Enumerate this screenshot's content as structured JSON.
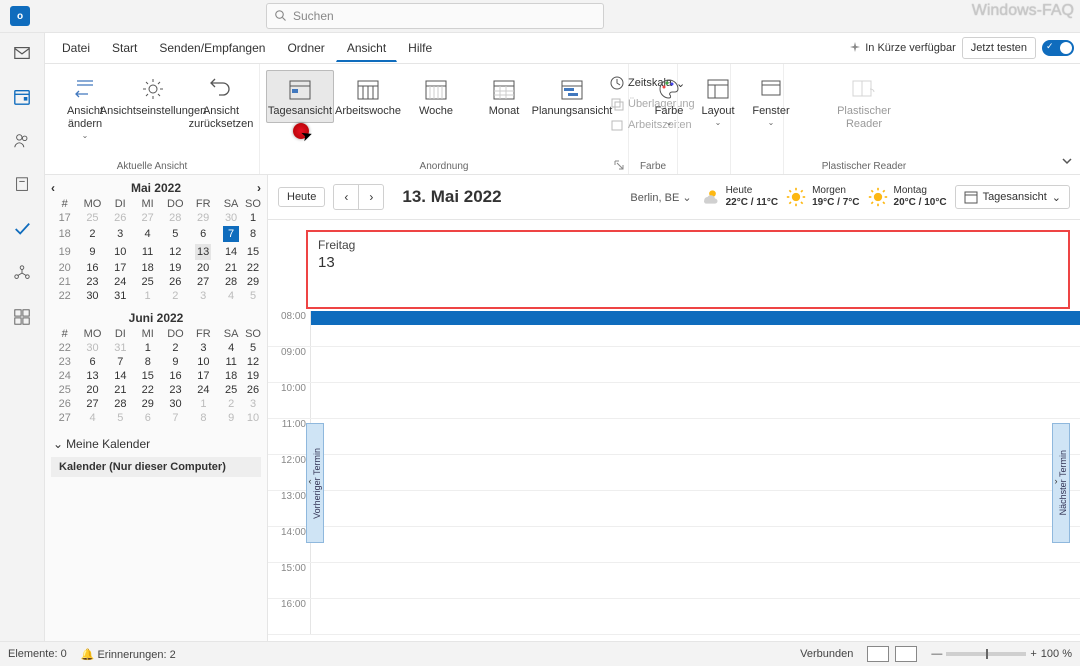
{
  "title_watermark": "Windows-FAQ",
  "search": {
    "placeholder": "Suchen"
  },
  "menu": {
    "items": [
      "Datei",
      "Start",
      "Senden/Empfangen",
      "Ordner",
      "Ansicht",
      "Hilfe"
    ],
    "active": 4,
    "coming_soon": "In Kürze verfügbar",
    "try_now": "Jetzt testen"
  },
  "ribbon": {
    "g_view": {
      "label": "Aktuelle Ansicht",
      "change": "Ansicht\nändern",
      "settings": "Ansichtseinstellungen",
      "reset": "Ansicht\nzurücksetzen"
    },
    "g_arr": {
      "label": "Anordnung",
      "day": "Tagesansicht",
      "workweek": "Arbeitswoche",
      "week": "Woche",
      "month": "Monat",
      "schedule": "Planungsansicht",
      "timescale": "Zeitskala",
      "overlay": "Überlagerung",
      "workhours": "Arbeitszeiten"
    },
    "g_color": {
      "label": "Farbe",
      "btn": "Farbe"
    },
    "g_layout": {
      "label": "",
      "btn": "Layout"
    },
    "g_window": {
      "label": "",
      "btn": "Fenster"
    },
    "g_reader": {
      "label": "Plastischer Reader",
      "btn": "Plastischer\nReader"
    }
  },
  "minical1": {
    "title": "Mai 2022",
    "dow": [
      "#",
      "MO",
      "DI",
      "MI",
      "DO",
      "FR",
      "SA",
      "SO"
    ],
    "rows": [
      {
        "wk": "17",
        "d": [
          "25",
          "26",
          "27",
          "28",
          "29",
          "30",
          "1"
        ],
        "other": [
          0,
          1,
          2,
          3,
          4,
          5
        ]
      },
      {
        "wk": "18",
        "d": [
          "2",
          "3",
          "4",
          "5",
          "6",
          "7",
          "8"
        ],
        "today": 5
      },
      {
        "wk": "19",
        "d": [
          "9",
          "10",
          "11",
          "12",
          "13",
          "14",
          "15"
        ],
        "sel": 4
      },
      {
        "wk": "20",
        "d": [
          "16",
          "17",
          "18",
          "19",
          "20",
          "21",
          "22"
        ]
      },
      {
        "wk": "21",
        "d": [
          "23",
          "24",
          "25",
          "26",
          "27",
          "28",
          "29"
        ]
      },
      {
        "wk": "22",
        "d": [
          "30",
          "31",
          "1",
          "2",
          "3",
          "4",
          "5"
        ],
        "other": [
          2,
          3,
          4,
          5,
          6
        ]
      }
    ]
  },
  "minical2": {
    "title": "Juni 2022",
    "dow": [
      "#",
      "MO",
      "DI",
      "MI",
      "DO",
      "FR",
      "SA",
      "SO"
    ],
    "rows": [
      {
        "wk": "22",
        "d": [
          "30",
          "31",
          "1",
          "2",
          "3",
          "4",
          "5"
        ],
        "other": [
          0,
          1
        ]
      },
      {
        "wk": "23",
        "d": [
          "6",
          "7",
          "8",
          "9",
          "10",
          "11",
          "12"
        ]
      },
      {
        "wk": "24",
        "d": [
          "13",
          "14",
          "15",
          "16",
          "17",
          "18",
          "19"
        ]
      },
      {
        "wk": "25",
        "d": [
          "20",
          "21",
          "22",
          "23",
          "24",
          "25",
          "26"
        ]
      },
      {
        "wk": "26",
        "d": [
          "27",
          "28",
          "29",
          "30",
          "1",
          "2",
          "3"
        ],
        "other": [
          4,
          5,
          6
        ]
      },
      {
        "wk": "27",
        "d": [
          "4",
          "5",
          "6",
          "7",
          "8",
          "9",
          "10"
        ],
        "other": [
          0,
          1,
          2,
          3,
          4,
          5,
          6
        ]
      }
    ]
  },
  "side": {
    "section": "Meine Kalender",
    "cal1": "Kalender (Nur dieser Computer)"
  },
  "caltop": {
    "today": "Heute",
    "date": "13. Mai 2022",
    "location": "Berlin, BE",
    "w1": {
      "label": "Heute",
      "temp": "22°C / 11°C"
    },
    "w2": {
      "label": "Morgen",
      "temp": "19°C / 7°C"
    },
    "w3": {
      "label": "Montag",
      "temp": "20°C / 10°C"
    },
    "viewsel": "Tagesansicht"
  },
  "day": {
    "name": "Freitag",
    "num": "13"
  },
  "hours": [
    "08:00",
    "09:00",
    "10:00",
    "11:00",
    "12:00",
    "13:00",
    "14:00",
    "15:00",
    "16:00"
  ],
  "handles": {
    "prev": "Vorheriger Termin",
    "next": "Nächster Termin"
  },
  "status": {
    "items": "Elemente: 0",
    "rem": "Erinnerungen: 2",
    "connected": "Verbunden",
    "zoom": "100 %"
  }
}
